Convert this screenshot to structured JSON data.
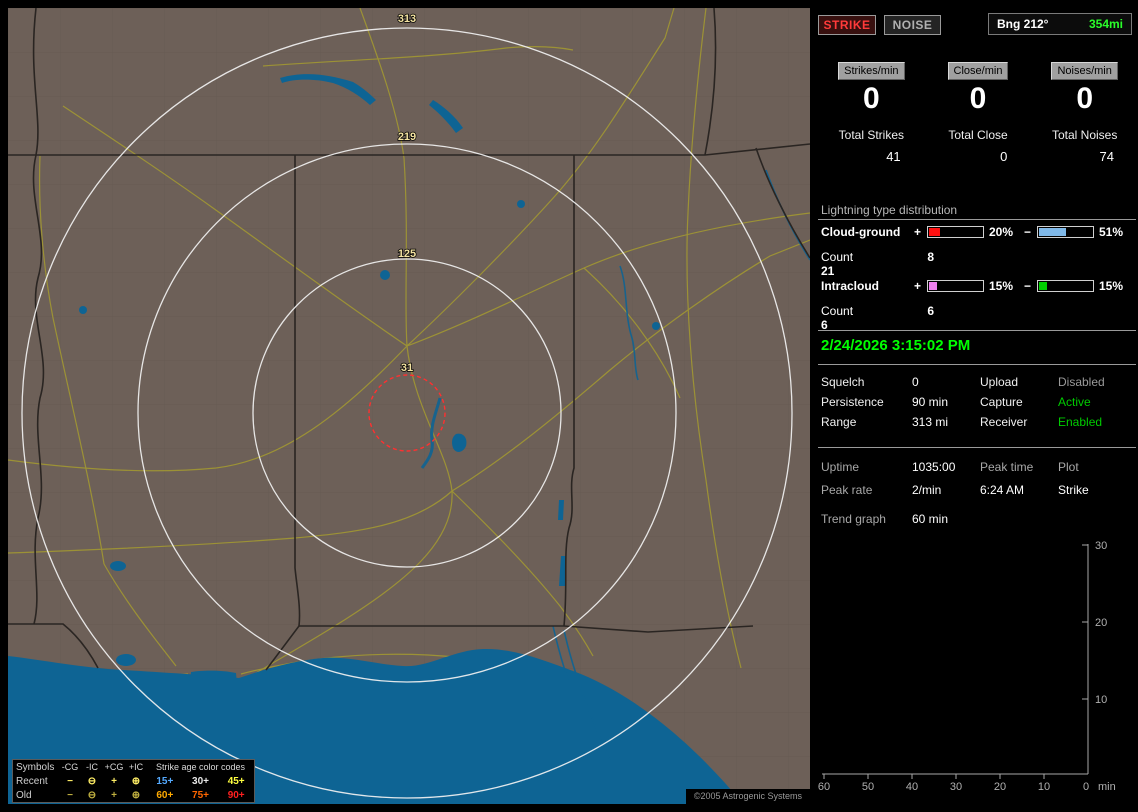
{
  "map": {
    "ring_labels": [
      "313",
      "219",
      "125",
      "31"
    ],
    "copyright": "©2005 Astrogenic Systems",
    "legend": {
      "symbols_label": "Symbols",
      "type_headers": [
        "-CG",
        "-IC",
        "+CG",
        "+IC"
      ],
      "age_header": "Strike age color codes",
      "rows": [
        {
          "label": "Recent",
          "symbols": [
            "−",
            "⊖",
            "+",
            "⊕"
          ],
          "ages": [
            {
              "text": "15+",
              "color": "#55aaff"
            },
            {
              "text": "30+",
              "color": "#e8e8e8"
            },
            {
              "text": "45+",
              "color": "#ffff40"
            }
          ]
        },
        {
          "label": "Old",
          "symbols": [
            "−",
            "⊖",
            "+",
            "⊕"
          ],
          "ages": [
            {
              "text": "60+",
              "color": "#ffaa00"
            },
            {
              "text": "75+",
              "color": "#ff6600"
            },
            {
              "text": "90+",
              "color": "#ff2020"
            }
          ]
        }
      ]
    }
  },
  "panel": {
    "strike_button": "STRIKE",
    "noise_button": "NOISE",
    "bearing": {
      "label": "Bng 212°",
      "value": "354mi"
    },
    "rate_columns": [
      {
        "badge": "Strikes/min",
        "rate": "0",
        "total_label": "Total Strikes",
        "total_value": "41"
      },
      {
        "badge": "Close/min",
        "rate": "0",
        "total_label": "Total Close",
        "total_value": "0"
      },
      {
        "badge": "Noises/min",
        "rate": "0",
        "total_label": "Total Noises",
        "total_value": "74"
      }
    ],
    "distribution": {
      "title": "Lightning type distribution",
      "count_label": "Count",
      "rows": [
        {
          "name": "Cloud-ground",
          "plus": "+",
          "minus": "−",
          "pos_pct": "20%",
          "neg_pct": "51%",
          "pos_width": 20,
          "neg_width": 51,
          "pos_color": "#ff1010",
          "neg_color": "#7fb8e8",
          "pos_count": "8",
          "neg_count": "21"
        },
        {
          "name": "Intracloud",
          "plus": "+",
          "minus": "−",
          "pos_pct": "15%",
          "neg_pct": "15%",
          "pos_width": 15,
          "neg_width": 15,
          "pos_color": "#f080f0",
          "neg_color": "#00d000",
          "pos_count": "6",
          "neg_count": "6"
        }
      ]
    },
    "datetime": "2/24/2026 3:15:02 PM",
    "settings": {
      "rows": [
        {
          "l1": "Squelch",
          "v1": "0",
          "l2": "Upload",
          "v2": "Disabled",
          "v2_color": "#9a9a9a"
        },
        {
          "l1": "Persistence",
          "v1": "90 min",
          "l2": "Capture",
          "v2": "Active",
          "v2_color": "#00cc00"
        },
        {
          "l1": "Range",
          "v1": "313 mi",
          "l2": "Receiver",
          "v2": "Enabled",
          "v2_color": "#00cc00"
        }
      ]
    },
    "stats": {
      "uptime_label": "Uptime",
      "uptime_value": "1035:00",
      "peak_time_label": "Peak time",
      "plot_label": "Plot",
      "peak_rate_label": "Peak rate",
      "peak_rate_value": "2/min",
      "peak_time_value": "6:24 AM",
      "plot_value": "Strike",
      "trend_label": "Trend graph",
      "trend_value": "60 min"
    },
    "trend": {
      "y_ticks": [
        "30",
        "20",
        "10"
      ],
      "x_ticks": [
        "60",
        "50",
        "40",
        "30",
        "20",
        "10",
        "0"
      ],
      "x_unit": "min"
    }
  }
}
